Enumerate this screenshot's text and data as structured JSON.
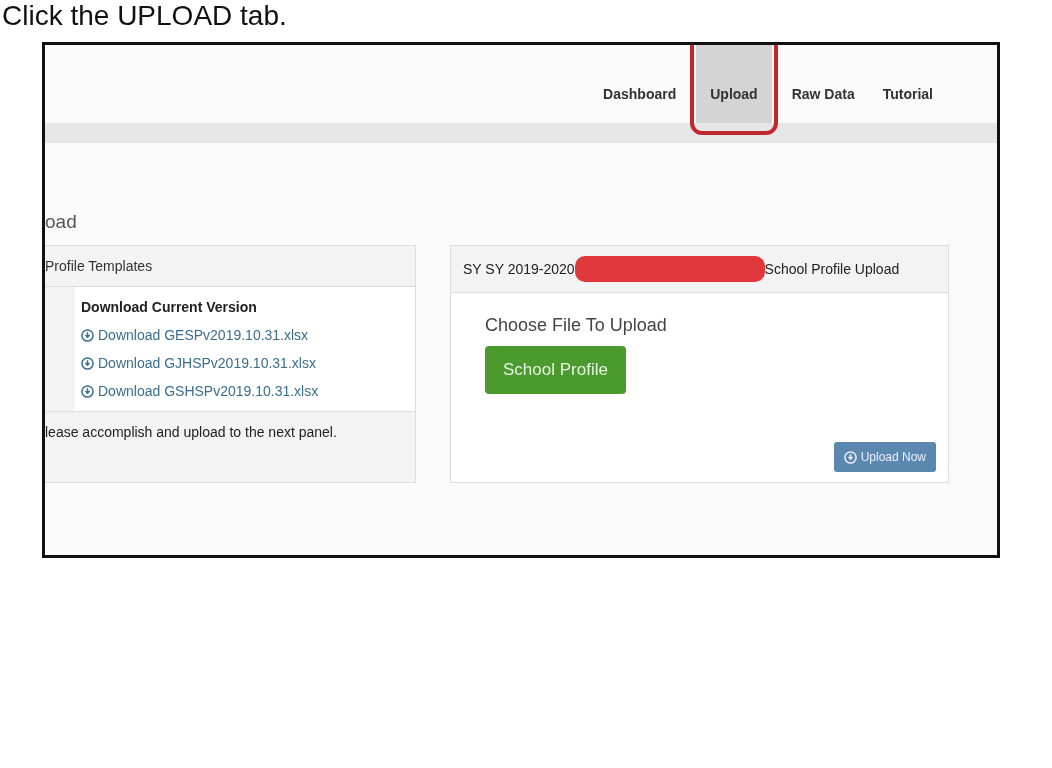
{
  "instruction": "Click the UPLOAD tab.",
  "nav": {
    "tabs": [
      {
        "label": "Dashboard",
        "selected": false
      },
      {
        "label": "Upload",
        "selected": true,
        "highlighted": true
      },
      {
        "label": "Raw Data",
        "selected": false
      },
      {
        "label": "Tutorial",
        "selected": false
      }
    ]
  },
  "page_title": "oad",
  "templates_panel": {
    "title": "Profile Templates",
    "heading": "Download Current Version",
    "links": [
      "Download GESPv2019.10.31.xlsx",
      "Download GJHSPv2019.10.31.xlsx",
      "Download GSHSPv2019.10.31.xlsx"
    ],
    "footer": "lease accomplish and upload to the next panel."
  },
  "upload_panel": {
    "title_start": "SY SY 2019-2020",
    "redacted": true,
    "title_end": "School Profile Upload",
    "label": "Choose File To Upload",
    "file_button": "School Profile",
    "submit_button": "Upload Now"
  }
}
